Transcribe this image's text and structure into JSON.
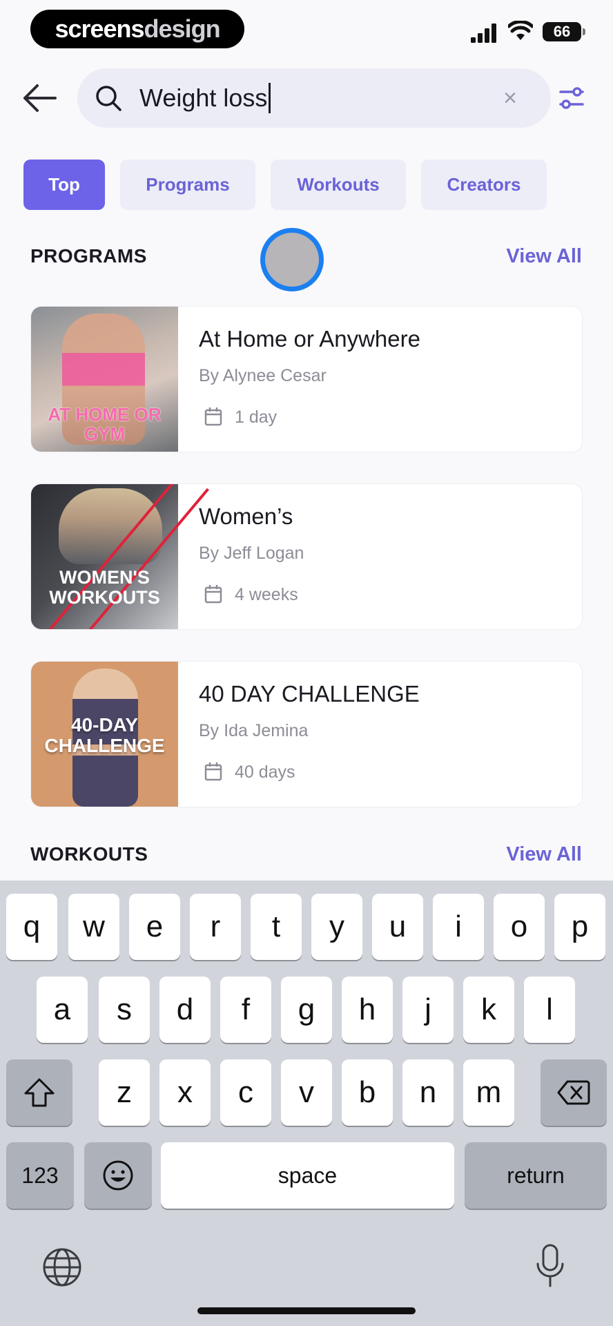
{
  "status_bar": {
    "logo_part1": "screens",
    "logo_part2": "design",
    "battery": "66"
  },
  "search": {
    "query": "Weight loss",
    "clear_glyph": "×"
  },
  "tabs": [
    {
      "label": "Top",
      "active": true
    },
    {
      "label": "Programs",
      "active": false
    },
    {
      "label": "Workouts",
      "active": false
    },
    {
      "label": "Creators",
      "active": false
    }
  ],
  "programs_section": {
    "title": "PROGRAMS",
    "view_all": "View All",
    "items": [
      {
        "title": "At Home or Anywhere",
        "author": "By Alynee Cesar",
        "duration": "1 day",
        "thumb_text": "AT HOME OR GYM"
      },
      {
        "title": "Women’s",
        "author": "By Jeff Logan",
        "duration": "4 weeks",
        "thumb_text": "WOMEN'S WORKOUTS"
      },
      {
        "title": "40 DAY CHALLENGE",
        "author": "By Ida Jemina",
        "duration": "40 days",
        "thumb_text": "40-DAY CHALLENGE"
      }
    ]
  },
  "workouts_section": {
    "title": "WORKOUTS",
    "view_all": "View All"
  },
  "keyboard": {
    "row1": [
      "q",
      "w",
      "e",
      "r",
      "t",
      "y",
      "u",
      "i",
      "o",
      "p"
    ],
    "row2": [
      "a",
      "s",
      "d",
      "f",
      "g",
      "h",
      "j",
      "k",
      "l"
    ],
    "row3": [
      "z",
      "x",
      "c",
      "v",
      "b",
      "n",
      "m"
    ],
    "numbers_key": "123",
    "space_key": "space",
    "return_key": "return"
  },
  "colors": {
    "accent": "#6c63e8",
    "accent_text": "#6a63d6",
    "tab_bg": "#ededf8",
    "touch_ring": "#1c7ff0"
  },
  "icons": [
    "signal-icon",
    "wifi-icon",
    "battery-icon",
    "back-arrow-icon",
    "search-icon",
    "clear-icon",
    "filter-icon",
    "calendar-icon",
    "shift-icon",
    "backspace-icon",
    "emoji-icon",
    "globe-icon",
    "microphone-icon"
  ]
}
